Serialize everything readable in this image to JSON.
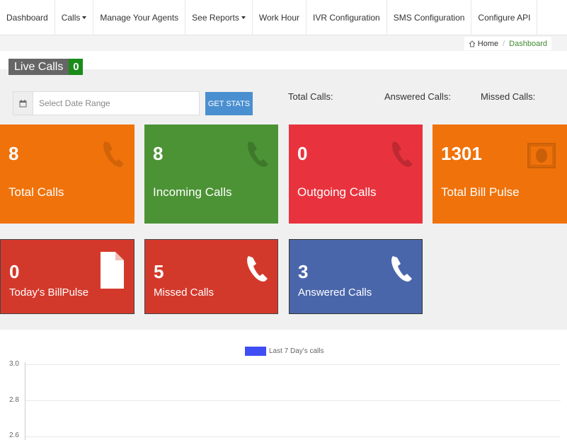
{
  "nav": {
    "items": [
      {
        "label": "Dashboard",
        "dropdown": false
      },
      {
        "label": "Calls",
        "dropdown": true
      },
      {
        "label": "Manage Your Agents",
        "dropdown": false
      },
      {
        "label": "See Reports",
        "dropdown": true
      },
      {
        "label": "Work Hour",
        "dropdown": false
      },
      {
        "label": "IVR Configuration",
        "dropdown": false
      },
      {
        "label": "SMS Configuration",
        "dropdown": false
      },
      {
        "label": "Configure API",
        "dropdown": false
      }
    ]
  },
  "breadcrumb": {
    "home": "Home",
    "separator": "/",
    "current": "Dashboard"
  },
  "live_calls": {
    "label": "Live Calls",
    "count": "0"
  },
  "filter": {
    "date_placeholder": "Select Date Range",
    "button": "GET STATS"
  },
  "stats": {
    "total": "Total Calls:",
    "answered": "Answered Calls:",
    "missed": "Missed Calls:"
  },
  "tiles": [
    {
      "value": "8",
      "label": "Total Calls",
      "color": "#f0720a",
      "icon": "phone-icon"
    },
    {
      "value": "8",
      "label": "Incoming Calls",
      "color": "#4c9335",
      "icon": "phone-icon"
    },
    {
      "value": "0",
      "label": "Outgoing Calls",
      "color": "#e8333e",
      "icon": "phone-icon"
    },
    {
      "value": "1301",
      "label": "Total Bill Pulse",
      "color": "#f0720a",
      "icon": "money-icon"
    },
    {
      "value": "0",
      "label": "Today's BillPulse",
      "color": "#d3392b",
      "icon": "file-icon"
    },
    {
      "value": "5",
      "label": "Missed Calls",
      "color": "#d3392b",
      "icon": "phone-icon"
    },
    {
      "value": "3",
      "label": "Answered Calls",
      "color": "#4a66ab",
      "icon": "phone-icon"
    }
  ],
  "chart_data": {
    "type": "bar",
    "series": [
      {
        "name": "Last 7 Day's calls",
        "color": "#3f4df5"
      }
    ],
    "y_ticks": [
      "3.0",
      "2.8",
      "2.6"
    ],
    "grid": true,
    "legend": "top-center"
  }
}
